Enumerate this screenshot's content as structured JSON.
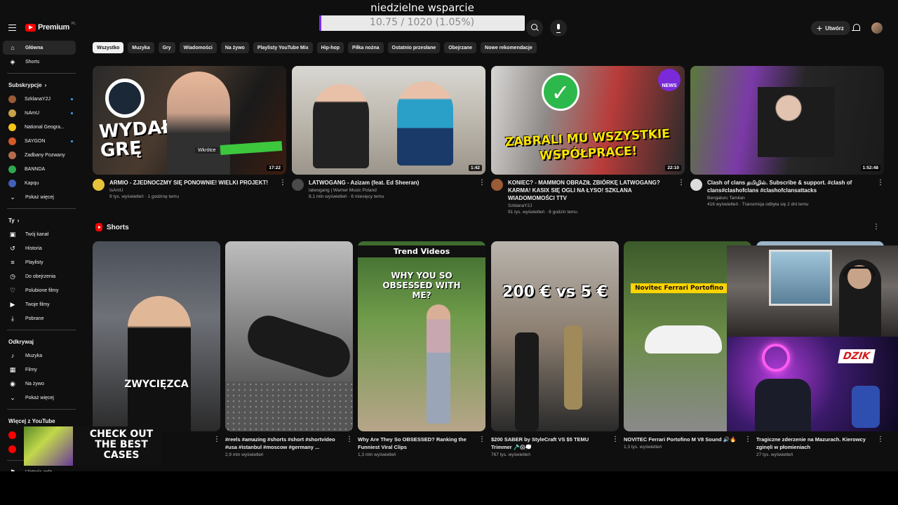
{
  "overlay": {
    "stream_title": "niedzielne wsparcie",
    "goal_text": "10.75 / 1020 (1.05%)",
    "goal_fraction": 0.0105,
    "promo_line1": "CHECK OUT",
    "promo_line2": "THE BEST",
    "promo_line3": "CASES",
    "accent_color": "#7b2bff"
  },
  "header": {
    "logo_text": "Premium",
    "logo_country": "PL",
    "create_label": "Utwórz"
  },
  "sidebar": {
    "main": [
      {
        "label": "Główna",
        "icon": "home-icon"
      },
      {
        "label": "Shorts",
        "icon": "shorts-icon"
      }
    ],
    "subs_heading": "Subskrypcje",
    "subscriptions": [
      {
        "label": "SzklanaY2J",
        "color": "#9a5b36"
      },
      {
        "label": "IsAmU",
        "color": "#c8a24a"
      },
      {
        "label": "National Geogra...",
        "color": "#f5c518"
      },
      {
        "label": "SAYGON",
        "color": "#d45a2a"
      },
      {
        "label": "Zadbany Pozwany",
        "color": "#b56b4d"
      },
      {
        "label": "BANNDA",
        "color": "#2fa84f"
      },
      {
        "label": "Kapqu",
        "color": "#4260b8"
      }
    ],
    "subs_more": "Pokaż więcej",
    "you_heading": "Ty",
    "you_items": [
      {
        "label": "Twój kanał",
        "icon": "user-icon"
      },
      {
        "label": "Historia",
        "icon": "history-icon"
      },
      {
        "label": "Playlisty",
        "icon": "playlist-icon"
      },
      {
        "label": "Do obejrzenia",
        "icon": "clock-icon"
      },
      {
        "label": "Polubione filmy",
        "icon": "like-icon"
      },
      {
        "label": "Twoje filmy",
        "icon": "video-icon"
      },
      {
        "label": "Pobrane",
        "icon": "download-icon"
      }
    ],
    "explore_heading": "Odkrywaj",
    "explore_items": [
      {
        "label": "Muzyka",
        "icon": "music-icon"
      },
      {
        "label": "Filmy",
        "icon": "film-icon"
      },
      {
        "label": "Na żywo",
        "icon": "live-icon"
      },
      {
        "label": "Pokaż więcej",
        "icon": "chevron-down-icon"
      }
    ],
    "more_heading": "Więcej z YouTube",
    "footer_item": "Historia zgło..."
  },
  "chips": [
    "Wszystko",
    "Muzyka",
    "Gry",
    "Wiadomości",
    "Na żywo",
    "Playlisty YouTube Mix",
    "Hip-hop",
    "Piłka nożna",
    "Ostatnio przesłane",
    "Obejrzane",
    "Nowe rekomendacje"
  ],
  "videos": [
    {
      "title": "ARMIO - ZJEDNOCZMY SIĘ PONOWNIE! WIELKI PROJEKT!",
      "channel": "IsAmU",
      "stats": "9 tys. wyświetleń · 1 godzinę temu",
      "duration": "17:22",
      "thumb_text": "WYDAŁEM GRĘ",
      "thumb_badge": "Wkrótce",
      "av_color": "#e6c23a",
      "bg": "linear-gradient(120deg, #2a2a2a 0%, #4a3a2e 40%, #1a1a1a 70%, #3b1d10 100%)"
    },
    {
      "title": "LATWOGANG - Azizam (feat. Ed Sheeran)",
      "channel": "latwogang | Warner Music Poland",
      "stats": "8,1 mln wyświetleń · 6 miesięcy temu",
      "duration": "1:42",
      "thumb_text": "",
      "thumb_badge": "",
      "av_color": "#4a4a4a",
      "bg": "linear-gradient(180deg, #d9d7d2 0%, #bdb8ae 50%, #9b948a 100%)"
    },
    {
      "title": "KONIEC? - MAMMON OBRAZIŁ ZBIÓRKĘ LATWOGANG? KARMA! KASIX SIĘ OGLI NA ŁYSO! SZKLANA WIADOMOMOŚCI TTV",
      "channel": "SzklanaY2J",
      "stats": "91 tys. wyświetleń · 8 godzin temu",
      "duration": "22:10",
      "thumb_text": "ZABRALI MU WSZYSTKIE WSPÓŁPRACE!",
      "thumb_badge": "NEWS",
      "av_color": "#9a5b36",
      "bg": "linear-gradient(100deg, #d8d6d4 0%, #8e8a88 30%, #b83c3a 60%, #2a2a2a 100%)"
    },
    {
      "title": "Clash of clans தமிழில். Subscribe & support. #clash of clans#clashofclans #clashofclansattacks",
      "channel": "Bengaluru Tamilan",
      "stats": "416 wyświetleń · Transmisja odbyła się 2 dni temu",
      "duration": "1:52:48",
      "thumb_text": "",
      "thumb_badge": "",
      "av_color": "#ddd",
      "bg": "linear-gradient(100deg, #5a7a3a 0%, #7b3aa8 30%, #262626 55%, #1a1a1a 100%)"
    }
  ],
  "shorts_heading": "Shorts",
  "shorts": [
    {
      "title": "",
      "views": "",
      "overlay": "ZWYCIĘZCA",
      "bg": "linear-gradient(180deg, #4a4f57 0%, #6e7178 40%, #2a2a2a 100%)"
    },
    {
      "title": "#reels #amazing #shorts #short #shortvideo #usa #istanbul #moscow #germany ...",
      "views": "2,9 mln wyświetleń",
      "overlay": "",
      "bg": "linear-gradient(180deg, #bdbdbd 0%, #8a8a8a 40%, #3a3a3a 100%)"
    },
    {
      "title": "Why Are They So OBSESSED? Ranking the Funniest Viral Clips",
      "views": "1,3 mln wyświetleń",
      "overlay": "WHY YOU SO OBSESSED WITH ME?",
      "top_text": "Trend Videos",
      "bg": "linear-gradient(180deg, #3d6a2f 0%, #6f9b4a 40%, #b7a58a 100%)"
    },
    {
      "title": "$200 SABER by StyleCraft VS $5 TEMU Trimmer 🪒😱💭",
      "views": "767 tys. wyświetleń",
      "overlay": "200 € vs 5 €",
      "bg": "linear-gradient(180deg, #b9b4ad 0%, #8a7d6f 50%, #2a2a2a 100%)"
    },
    {
      "title": "NOVITEC Ferrari Portofino M V8 Sound 🔊🔥",
      "views": "1,3 tys. wyświetleń",
      "overlay": "Novitec Ferrari Portofino",
      "bg": "linear-gradient(180deg, #3b5a2a 0%, #6c8c4a 50%, #8a8a8a 100%)"
    },
    {
      "title": "Tragiczne zderzenie na Mazurach. Kierowcy zginęli w płomieniach",
      "views": "27 tys. wyświetleń",
      "overlay": "",
      "bg": "linear-gradient(180deg, #9db5c8 0%, #7e8f9c 50%, #3a3a3a 100%)"
    }
  ],
  "webcam_label": "DZIK"
}
